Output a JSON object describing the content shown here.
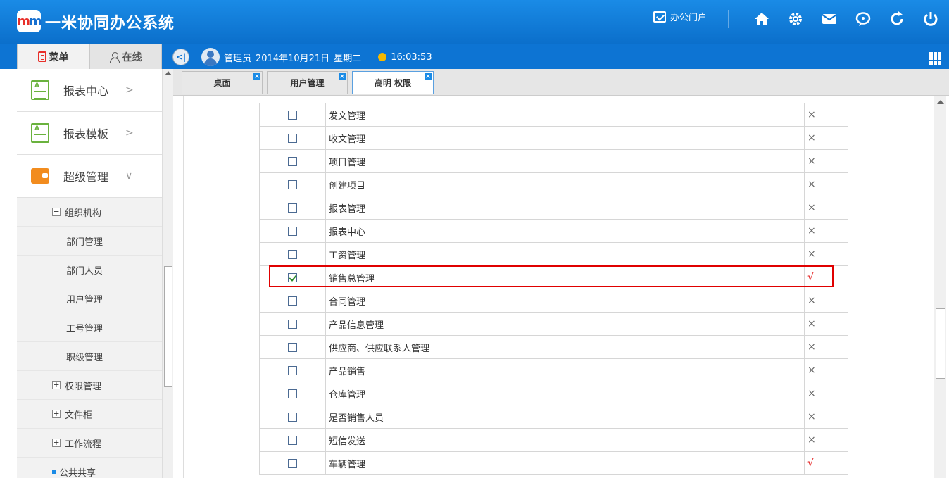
{
  "header": {
    "logo_text": "m",
    "title": "一米协同办公系统",
    "portal_label": "办公门户",
    "icons": [
      "home-icon",
      "gear-icon",
      "mail-icon",
      "message-icon",
      "refresh-icon",
      "power-icon"
    ]
  },
  "menu_tabs": {
    "menu_label": "菜单",
    "online_label": "在线"
  },
  "userbar": {
    "user": "管理员",
    "date": "2014年10月21日",
    "weekday": "星期二",
    "time": "16:03:53"
  },
  "sidebar": {
    "items": [
      {
        "label": "报表中心",
        "icon": "report-icon"
      },
      {
        "label": "报表模板",
        "icon": "report-icon"
      },
      {
        "label": "超级管理",
        "icon": "wallet-icon"
      }
    ],
    "tree": {
      "org": "组织机构",
      "org_children": [
        "部门管理",
        "部门人员",
        "用户管理",
        "工号管理",
        "职级管理"
      ],
      "permission": "权限管理",
      "file_cabinet": "文件柜",
      "workflow": "工作流程",
      "public_share": "公共共享"
    }
  },
  "content_tabs": [
    {
      "label": "桌面"
    },
    {
      "label": "用户管理"
    },
    {
      "label": "高明 权限"
    }
  ],
  "permissions": [
    {
      "name": "发文管理",
      "checked": false,
      "mark": "×"
    },
    {
      "name": "收文管理",
      "checked": false,
      "mark": "×"
    },
    {
      "name": "项目管理",
      "checked": false,
      "mark": "×"
    },
    {
      "name": "创建项目",
      "checked": false,
      "mark": "×"
    },
    {
      "name": "报表管理",
      "checked": false,
      "mark": "×"
    },
    {
      "name": "报表中心",
      "checked": false,
      "mark": "×"
    },
    {
      "name": "工资管理",
      "checked": false,
      "mark": "×"
    },
    {
      "name": "销售总管理",
      "checked": true,
      "mark": "√"
    },
    {
      "name": "合同管理",
      "checked": false,
      "mark": "×"
    },
    {
      "name": "产品信息管理",
      "checked": false,
      "mark": "×"
    },
    {
      "name": "供应商、供应联系人管理",
      "checked": false,
      "mark": "×"
    },
    {
      "name": "产品销售",
      "checked": false,
      "mark": "×"
    },
    {
      "name": "仓库管理",
      "checked": false,
      "mark": "×"
    },
    {
      "name": "是否销售人员",
      "checked": false,
      "mark": "×"
    },
    {
      "name": "短信发送",
      "checked": false,
      "mark": "×"
    },
    {
      "name": "车辆管理",
      "checked": false,
      "mark": "√"
    }
  ],
  "colors": {
    "header_blue": "#0d74d3",
    "check_mark_red": "#e00000",
    "highlight_border": "#e00000"
  }
}
